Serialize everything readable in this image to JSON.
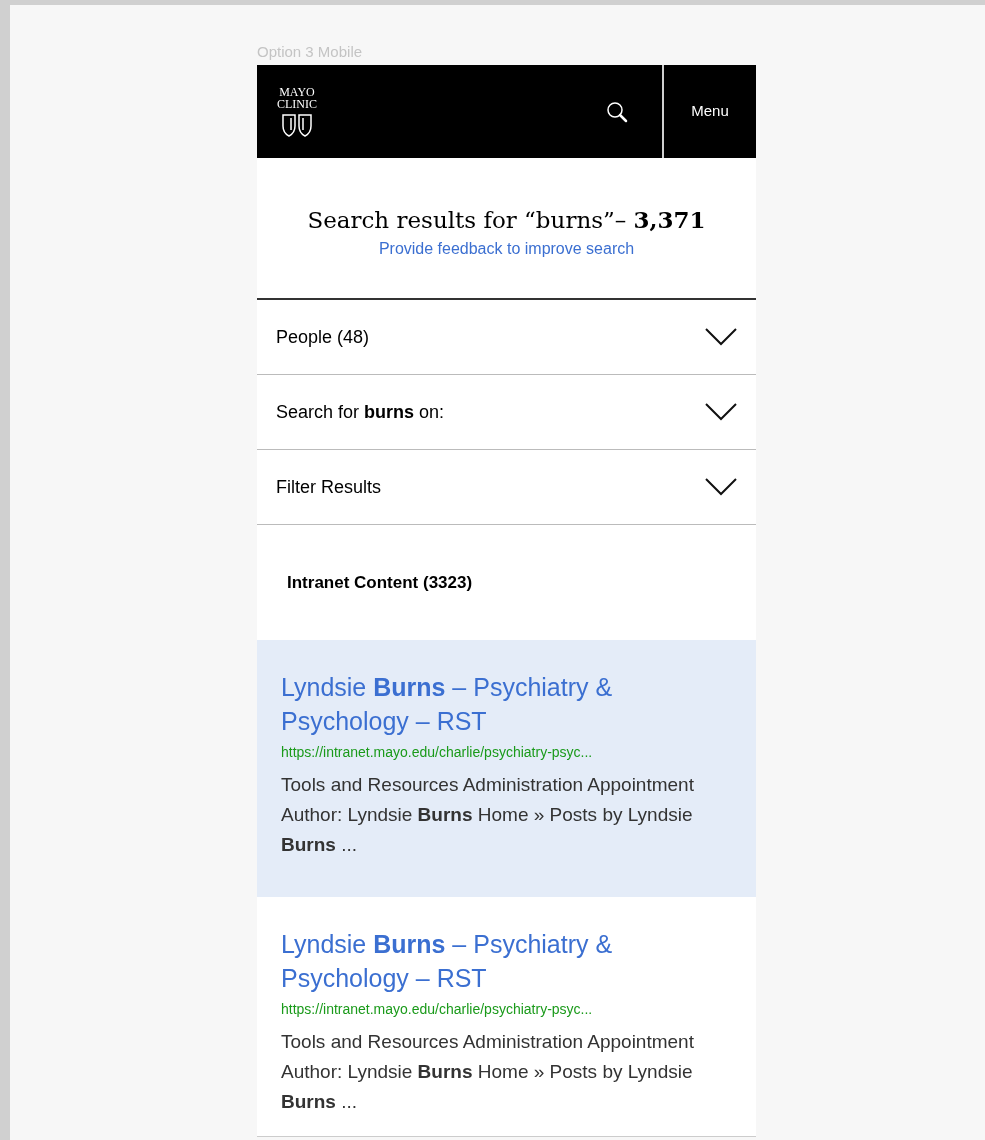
{
  "frame_label": "Option 3 Mobile",
  "header": {
    "logo_lines": [
      "MAYO",
      "CLINIC"
    ],
    "menu_label": "Menu"
  },
  "search_heading": {
    "title": "Search results for “burns”– **3,371**",
    "feedback_link": "Provide feedback to improve search"
  },
  "accordions": [
    {
      "label": "People (48)",
      "expanded": false
    },
    {
      "label": "Search for **burns** on:",
      "expanded": false
    },
    {
      "label": "Filter Results",
      "expanded": false
    }
  ],
  "section_title": "Intranet Content (3323)",
  "results": [
    {
      "title": "Lyndsie **Burns** – Psychiatry & Psychology – RST",
      "url": "https://intranet.mayo.edu/charlie/psychiatry-psyc...",
      "snippet": "Tools and Resources Administration Appointment Author: Lyndsie **Burns** Home » Posts by Lyndsie **Burns** ...",
      "highlighted": true
    },
    {
      "title": "Lyndsie **Burns** – Psychiatry & Psychology – RST",
      "url": "https://intranet.mayo.edu/charlie/psychiatry-psyc...",
      "snippet": "Tools and Resources Administration Appointment Author: Lyndsie **Burns** Home » Posts by Lyndsie **Burns** ...",
      "highlighted": false
    }
  ]
}
